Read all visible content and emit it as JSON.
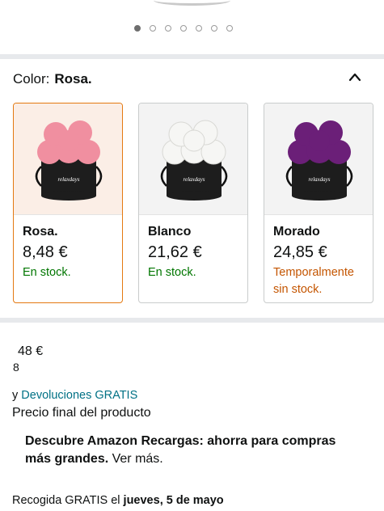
{
  "carousel": {
    "dot_count": 7,
    "active_index": 0
  },
  "color_selector": {
    "label": "Color:",
    "selected_value": "Rosa.",
    "options": [
      {
        "name": "Rosa.",
        "price": "8,48 €",
        "stock": "En stock.",
        "selected": true,
        "flower_color": "#f08fa0",
        "stock_color": "#007600"
      },
      {
        "name": "Blanco",
        "price": "21,62 €",
        "stock": "En stock.",
        "selected": false,
        "flower_color": "#f6f6f4",
        "stock_color": "#007600"
      },
      {
        "name": "Morado",
        "price": "24,85 €",
        "stock": "Temporalmente sin stock.",
        "selected": false,
        "flower_color": "#6b1f78",
        "stock_color": "#c45500"
      }
    ],
    "box_brand_text": "relaxdays"
  },
  "price": {
    "main": "48 €",
    "fraction": "8"
  },
  "returns": {
    "prefix": "y ",
    "link": "Devoluciones GRATIS"
  },
  "final_price_label": "Precio final del producto",
  "promo": {
    "bold": "Descubre Amazon Recargas: ahorra para compras más grandes.",
    "link": "Ver más."
  },
  "pickup": {
    "text": "Recogida GRATIS el ",
    "date": "jueves, 5 de mayo"
  }
}
